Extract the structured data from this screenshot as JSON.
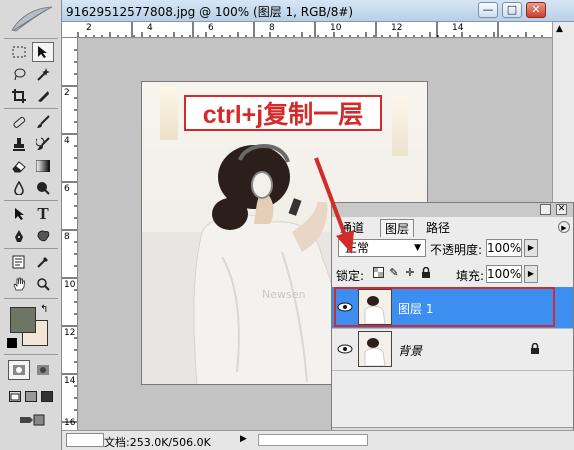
{
  "window": {
    "title": "91629512577808.jpg @ 100% (图层 1, RGB/8#)",
    "minimize": "—",
    "maximize": "□",
    "close": "✕"
  },
  "ruler": {
    "h_labels": [
      "2",
      "4",
      "6",
      "8",
      "10",
      "12",
      "14"
    ],
    "v_labels": [
      "2",
      "4",
      "6",
      "8",
      "10",
      "12",
      "14",
      "16"
    ]
  },
  "annotation": {
    "text": "ctrl+j复制一层"
  },
  "photo": {
    "watermark": "Newsen"
  },
  "status": {
    "doc_size": "文档:253.0K/506.0K",
    "arrow": "▶"
  },
  "layers_panel": {
    "tabs": [
      "通道",
      "图层",
      "路径"
    ],
    "active_tab": "图层",
    "blend_mode": "正常",
    "opacity_label": "不透明度:",
    "opacity_value": "100%",
    "lock_label": "锁定:",
    "fill_label": "填充:",
    "fill_value": "100%",
    "layers": [
      {
        "name": "图层 1",
        "selected": true
      },
      {
        "name": "背景",
        "selected": false
      }
    ]
  },
  "colors": {
    "accent_red": "#d42a2a",
    "selection_blue": "#3c8ff0",
    "foreground": "#6f7565",
    "background": "#f2e6d6"
  },
  "icons": {
    "tools": [
      "marquee-icon",
      "move-icon",
      "lasso-icon",
      "magic-wand-icon",
      "crop-icon",
      "slice-icon",
      "healing-icon",
      "brush-icon",
      "stamp-icon",
      "history-brush-icon",
      "eraser-icon",
      "gradient-icon",
      "blur-icon",
      "dodge-icon",
      "path-select-icon",
      "type-icon",
      "pen-icon",
      "shape-icon",
      "notes-icon",
      "eyedropper-icon",
      "hand-icon",
      "zoom-icon"
    ]
  }
}
